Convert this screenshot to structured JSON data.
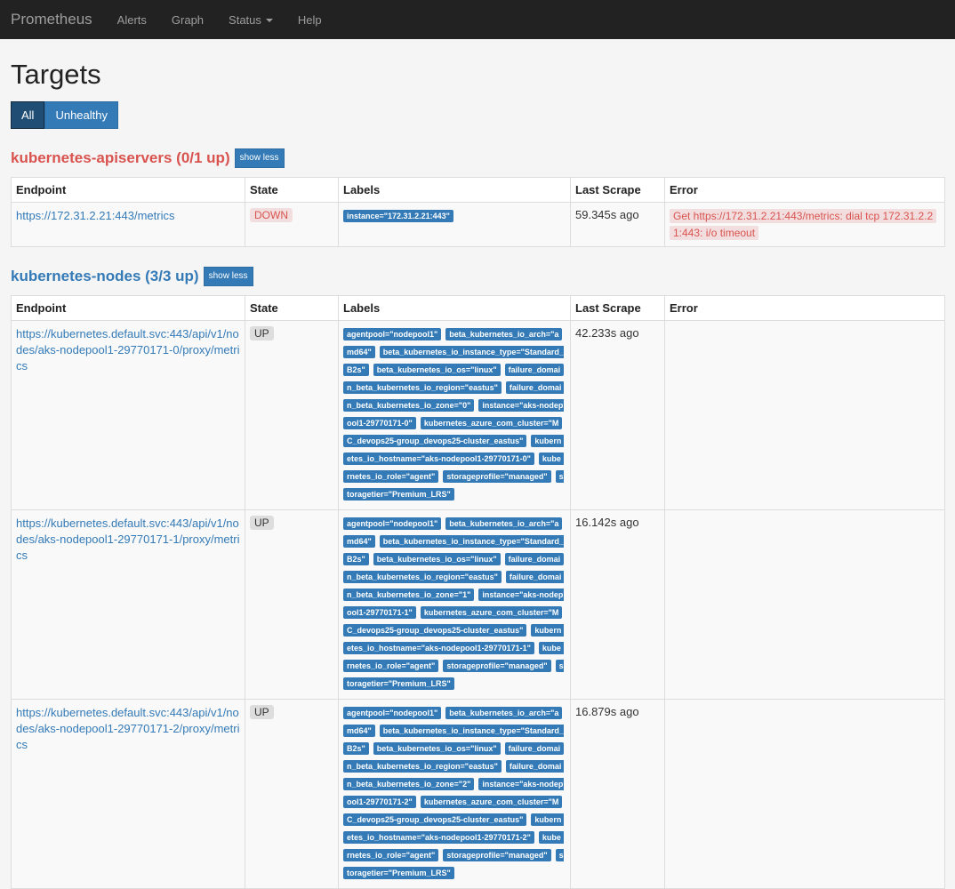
{
  "nav": {
    "brand": "Prometheus",
    "items": [
      "Alerts",
      "Graph",
      "Status",
      "Help"
    ]
  },
  "page": {
    "title": "Targets",
    "filters": [
      "All",
      "Unhealthy"
    ]
  },
  "columns": [
    "Endpoint",
    "State",
    "Labels",
    "Last Scrape",
    "Error"
  ],
  "jobs": [
    {
      "title": "kubernetes-apiservers (0/1 up)",
      "toggle": "show less",
      "health": "danger",
      "rows": [
        {
          "endpoint": "https://172.31.2.21:443/metrics",
          "state": "DOWN",
          "labels": [
            "instance=\"172.31.2.21:443\""
          ],
          "last_scrape": "59.345s ago",
          "error": "Get https://172.31.2.21:443/metrics: dial tcp 172.31.2.21:443: i/o timeout"
        }
      ]
    },
    {
      "title": "kubernetes-nodes (3/3 up)",
      "toggle": "show less",
      "health": "ok",
      "rows": [
        {
          "endpoint": "https://kubernetes.default.svc:443/api/v1/nodes/aks-nodepool1-29770171-0/proxy/metrics",
          "state": "UP",
          "labels": [
            "agentpool=\"nodepool1\"",
            "beta_kubernetes_io_arch=\"amd64\"",
            "beta_kubernetes_io_instance_type=\"Standard_B2s\"",
            "beta_kubernetes_io_os=\"linux\"",
            "failure_domain_beta_kubernetes_io_region=\"eastus\"",
            "failure_domain_beta_kubernetes_io_zone=\"0\"",
            "instance=\"aks-nodepool1-29770171-0\"",
            "kubernetes_azure_com_cluster=\"MC_devops25-group_devops25-cluster_eastus\"",
            "kubernetes_io_hostname=\"aks-nodepool1-29770171-0\"",
            "kubernetes_io_role=\"agent\"",
            "storageprofile=\"managed\"",
            "storagetier=\"Premium_LRS\""
          ],
          "last_scrape": "42.233s ago",
          "error": ""
        },
        {
          "endpoint": "https://kubernetes.default.svc:443/api/v1/nodes/aks-nodepool1-29770171-1/proxy/metrics",
          "state": "UP",
          "labels": [
            "agentpool=\"nodepool1\"",
            "beta_kubernetes_io_arch=\"amd64\"",
            "beta_kubernetes_io_instance_type=\"Standard_B2s\"",
            "beta_kubernetes_io_os=\"linux\"",
            "failure_domain_beta_kubernetes_io_region=\"eastus\"",
            "failure_domain_beta_kubernetes_io_zone=\"1\"",
            "instance=\"aks-nodepool1-29770171-1\"",
            "kubernetes_azure_com_cluster=\"MC_devops25-group_devops25-cluster_eastus\"",
            "kubernetes_io_hostname=\"aks-nodepool1-29770171-1\"",
            "kubernetes_io_role=\"agent\"",
            "storageprofile=\"managed\"",
            "storagetier=\"Premium_LRS\""
          ],
          "last_scrape": "16.142s ago",
          "error": ""
        },
        {
          "endpoint": "https://kubernetes.default.svc:443/api/v1/nodes/aks-nodepool1-29770171-2/proxy/metrics",
          "state": "UP",
          "labels": [
            "agentpool=\"nodepool1\"",
            "beta_kubernetes_io_arch=\"amd64\"",
            "beta_kubernetes_io_instance_type=\"Standard_B2s\"",
            "beta_kubernetes_io_os=\"linux\"",
            "failure_domain_beta_kubernetes_io_region=\"eastus\"",
            "failure_domain_beta_kubernetes_io_zone=\"2\"",
            "instance=\"aks-nodepool1-29770171-2\"",
            "kubernetes_azure_com_cluster=\"MC_devops25-group_devops25-cluster_eastus\"",
            "kubernetes_io_hostname=\"aks-nodepool1-29770171-2\"",
            "kubernetes_io_role=\"agent\"",
            "storageprofile=\"managed\"",
            "storagetier=\"Premium_LRS\""
          ],
          "last_scrape": "16.879s ago",
          "error": ""
        }
      ]
    }
  ]
}
